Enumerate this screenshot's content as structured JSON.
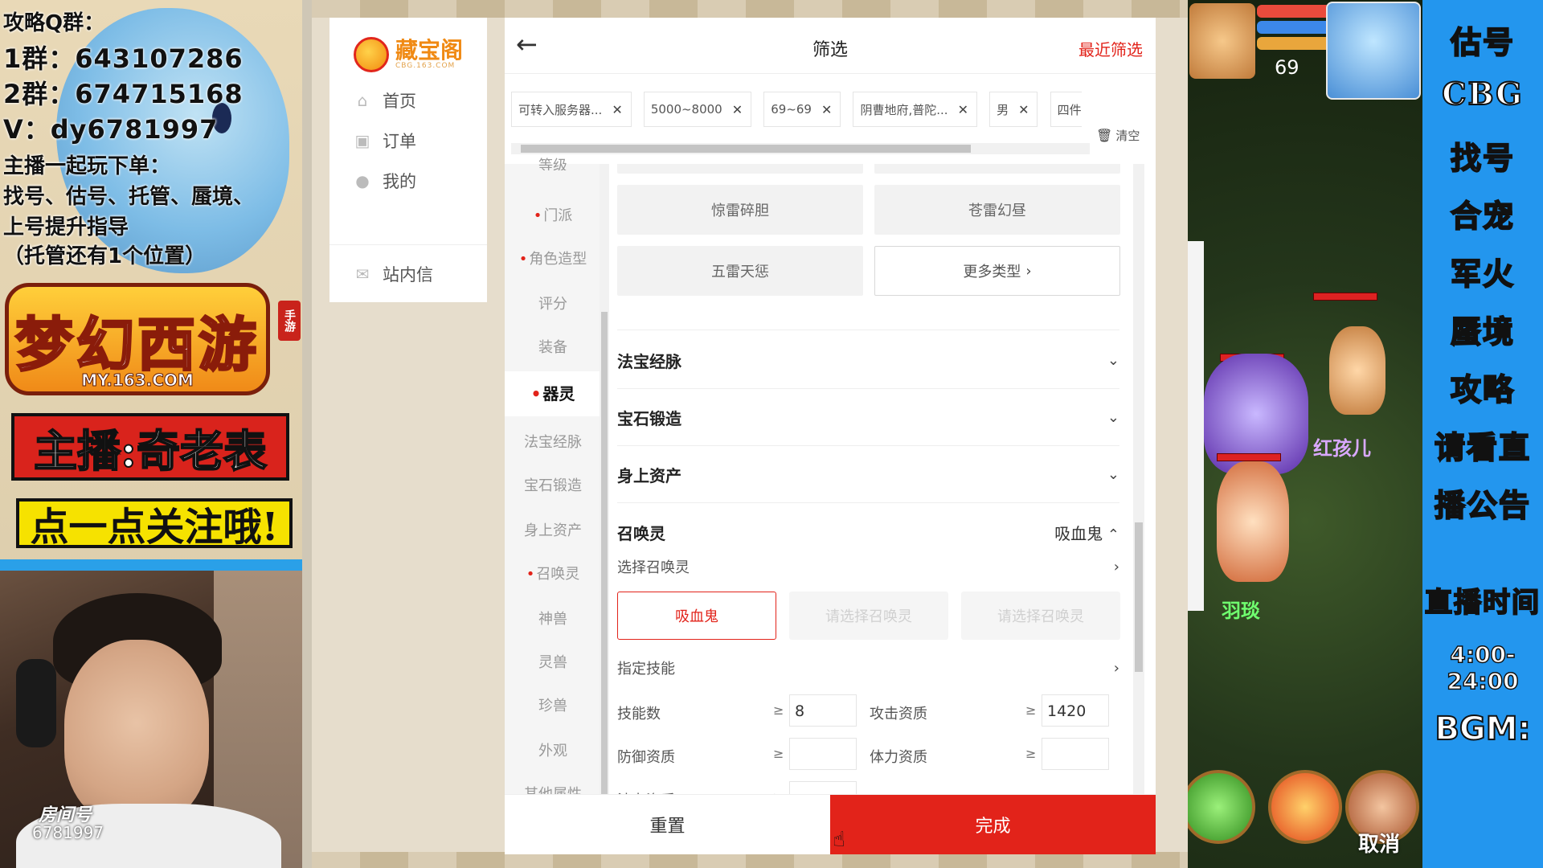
{
  "overlay_left": {
    "qq_title": "攻略Q群：",
    "group1": "1群：643107286",
    "group2": "2群：674715168",
    "vx": "V：dy6781997",
    "services_title": "主播一起玩下单：",
    "services_line1": "找号、估号、托管、蜃境、",
    "services_line2": "上号提升指导",
    "services_note": "（托管还有1个位置）",
    "game_logo": "梦幻西游",
    "game_logo_tag": "手游",
    "game_url": "MY.163.COM",
    "streamer_banner": "主播:奇老表",
    "follow_banner": "点一点关注哦!",
    "room_label": "房间号",
    "room_number": "6781997"
  },
  "cbg": {
    "logo_name": "藏宝阁",
    "logo_sub": "CBG.163.COM",
    "nav": [
      {
        "label": "首页",
        "icon": "home-icon"
      },
      {
        "label": "订单",
        "icon": "order-icon"
      },
      {
        "label": "我的",
        "icon": "user-icon"
      },
      {
        "label": "站内信",
        "icon": "mail-icon"
      }
    ],
    "header": {
      "title": "筛选",
      "recent": "最近筛选",
      "back_icon": "arrow-left-icon"
    },
    "chips": [
      "可转入服务器...",
      "5000~8000",
      "69~69",
      "阴曹地府,普陀...",
      "男",
      "四件套"
    ],
    "clear_label": "清空",
    "categories": [
      {
        "label": "等级",
        "required": false
      },
      {
        "label": "门派",
        "required": true
      },
      {
        "label": "角色造型",
        "required": true
      },
      {
        "label": "评分",
        "required": false
      },
      {
        "label": "装备",
        "required": false
      },
      {
        "label": "器灵",
        "required": true
      },
      {
        "label": "法宝经脉",
        "required": false
      },
      {
        "label": "宝石锻造",
        "required": false
      },
      {
        "label": "身上资产",
        "required": false
      },
      {
        "label": "召唤灵",
        "required": true
      },
      {
        "label": "神兽",
        "required": false
      },
      {
        "label": "灵兽",
        "required": false
      },
      {
        "label": "珍兽",
        "required": false
      },
      {
        "label": "外观",
        "required": false
      },
      {
        "label": "其他属性",
        "required": false
      }
    ],
    "type_options": [
      "惊雷碎胆",
      "苍雷幻昼",
      "五雷天惩"
    ],
    "more_types": "更多类型",
    "sections": [
      "法宝经脉",
      "宝石锻造",
      "身上资产"
    ],
    "summon": {
      "title": "召唤灵",
      "selected_summary": "吸血鬼",
      "choose_label": "选择召唤灵",
      "pets": [
        "吸血鬼",
        "请选择召唤灵",
        "请选择召唤灵"
      ],
      "skill_label": "指定技能",
      "fields": [
        {
          "label": "技能数",
          "value": "8"
        },
        {
          "label": "攻击资质",
          "value": "1420"
        },
        {
          "label": "防御资质",
          "value": ""
        },
        {
          "label": "体力资质",
          "value": ""
        },
        {
          "label": "法力资质",
          "value": ""
        }
      ],
      "ge": "≥"
    },
    "footer": {
      "reset": "重置",
      "done": "完成"
    }
  },
  "game": {
    "level": "69",
    "names": [
      "红孩儿",
      "羽琰"
    ],
    "cancel": "取消"
  },
  "right_menu": {
    "items": [
      "估号",
      "CBG",
      "找号",
      "合宠",
      "军火",
      "蜃境",
      "攻略",
      "请看直",
      "播公告"
    ],
    "time_label": "直播时间",
    "time": "4:00-24:00",
    "bgm": "BGM:"
  }
}
